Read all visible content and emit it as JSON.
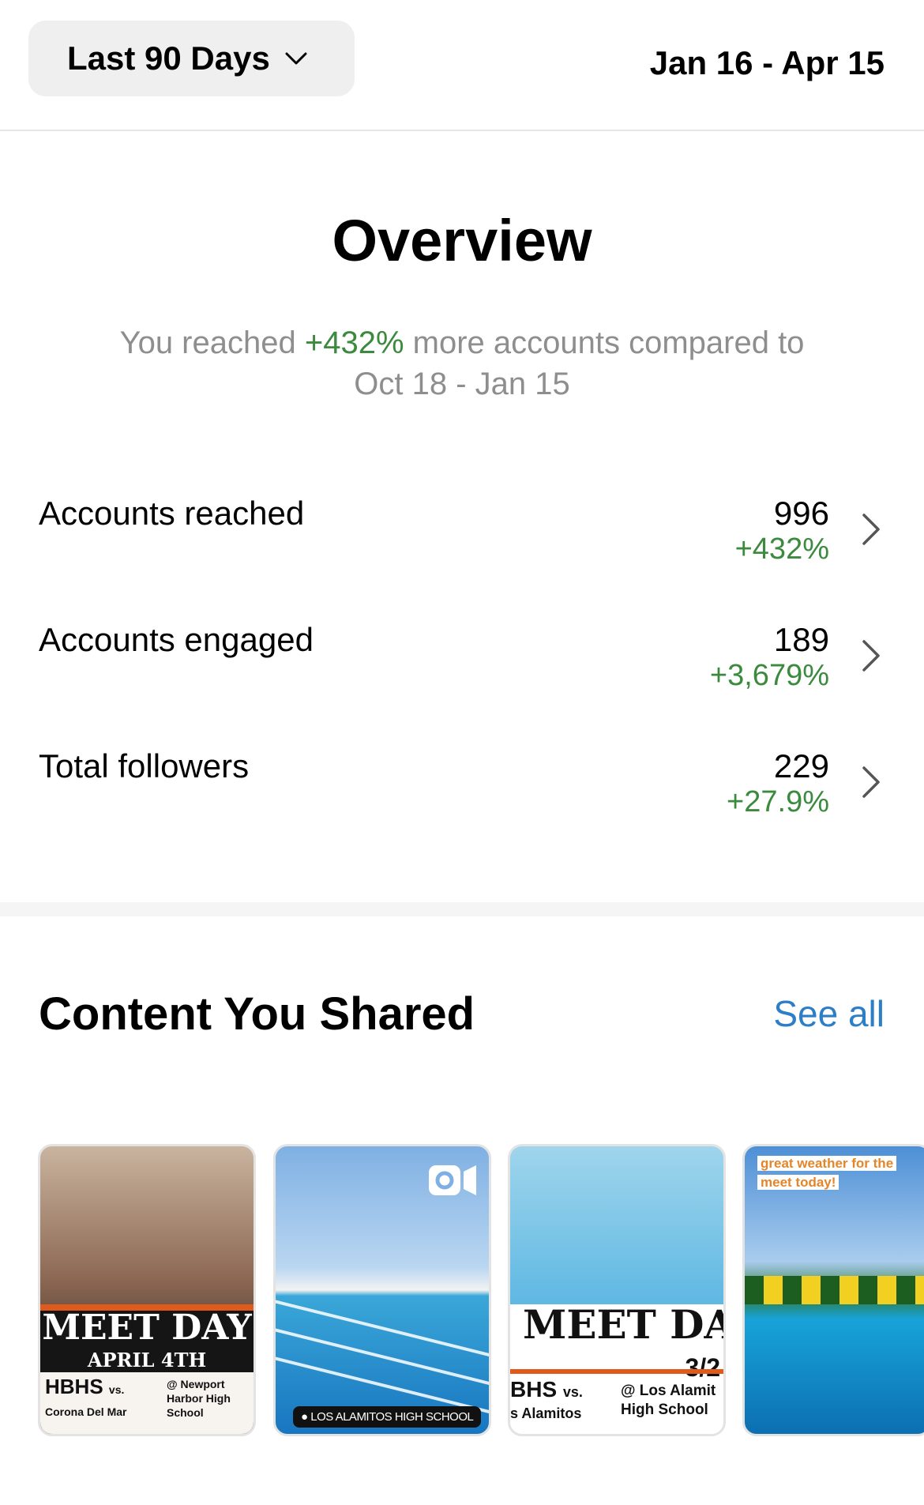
{
  "header": {
    "range_label": "Last 90 Days",
    "date_range": "Jan 16 - Apr 15"
  },
  "overview": {
    "title": "Overview",
    "subtitle_prefix": "You reached ",
    "subtitle_highlight": "+432%",
    "subtitle_suffix": " more accounts compared to",
    "subtitle_line2": "Oct 18 - Jan 15"
  },
  "metrics": [
    {
      "label": "Accounts reached",
      "value": "996",
      "change": "+432%"
    },
    {
      "label": "Accounts engaged",
      "value": "189",
      "change": "+3,679%"
    },
    {
      "label": "Total followers",
      "value": "229",
      "change": "+27.9%"
    }
  ],
  "content": {
    "title": "Content You Shared",
    "see_all": "See all",
    "items": [
      {
        "kind": "post",
        "headline": "MEET DAY",
        "subhead": "APRIL 4TH",
        "team": "HBHS",
        "vs": "vs.",
        "opponent": "Corona Del Mar",
        "venue": "@ Newport Harbor High School"
      },
      {
        "kind": "reel",
        "location": "LOS ALAMITOS HIGH SCHOOL"
      },
      {
        "kind": "post",
        "headline": "MEET DA",
        "date": "3/2",
        "team": "BHS",
        "vs": "vs.",
        "opponent": "s Alamitos",
        "venue": "@ Los Alamit",
        "venue2": "High School"
      },
      {
        "kind": "story",
        "caption_line1": "great weather for the",
        "caption_line2": "meet today!"
      }
    ]
  },
  "colors": {
    "positive": "#3b8a3e",
    "link": "#2c7fc7",
    "muted": "#8e8e8e"
  }
}
